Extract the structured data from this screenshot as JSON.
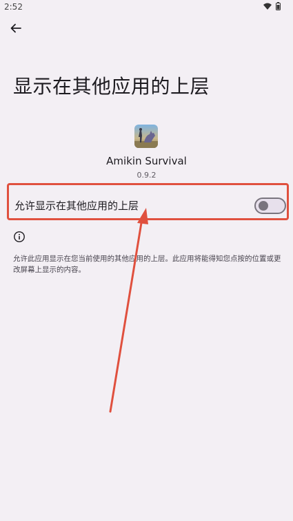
{
  "status_bar": {
    "time": "2:52"
  },
  "header": {
    "back_icon": "arrow-left-icon",
    "title": "显示在其他应用的上层"
  },
  "app": {
    "name": "Amikin Survival",
    "version": "0.9.2"
  },
  "permission": {
    "label": "允许显示在其他应用的上层",
    "enabled": false
  },
  "info": {
    "icon": "info-icon",
    "description": "允许此应用显示在您当前使用的其他应用的上层。此应用将能得知您点按的位置或更改屏幕上显示的内容。"
  },
  "annotation": {
    "highlight_color": "#e0503e"
  }
}
